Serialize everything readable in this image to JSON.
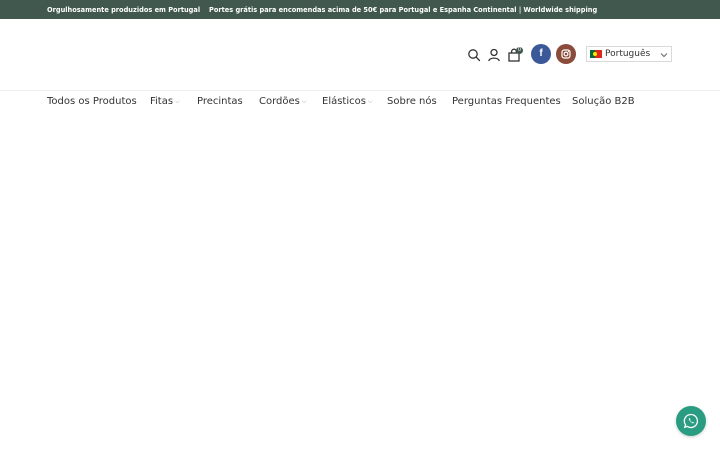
{
  "topbar": {
    "left_text": "Orgulhosamente produzidos em Portugal",
    "center_text": "Portes grátis para encomendas acima de 50€ para Portugal e Espanha Continental | Worldwide shipping"
  },
  "header": {
    "cart_count": "0",
    "facebook_glyph": "f",
    "language": {
      "selected": "Português"
    },
    "icons": [
      "search-icon",
      "user-icon",
      "cart-icon",
      "facebook-icon",
      "instagram-icon",
      "chevron-down-icon"
    ]
  },
  "nav": {
    "items": [
      {
        "label": "Todos os Produtos",
        "has_dropdown": false
      },
      {
        "label": "Fitas",
        "has_dropdown": true
      },
      {
        "label": "Precintas",
        "has_dropdown": false
      },
      {
        "label": "Cordões",
        "has_dropdown": true
      },
      {
        "label": "Elásticos",
        "has_dropdown": true
      },
      {
        "label": "Sobre nós",
        "has_dropdown": false
      },
      {
        "label": "Perguntas Frequentes",
        "has_dropdown": false
      },
      {
        "label": "Solução B2B",
        "has_dropdown": false
      }
    ]
  },
  "colors": {
    "topbar_bg": "#40584e",
    "facebook": "#3b5998",
    "instagram": "#8a4b3a",
    "whatsapp": "#2a9c82"
  }
}
